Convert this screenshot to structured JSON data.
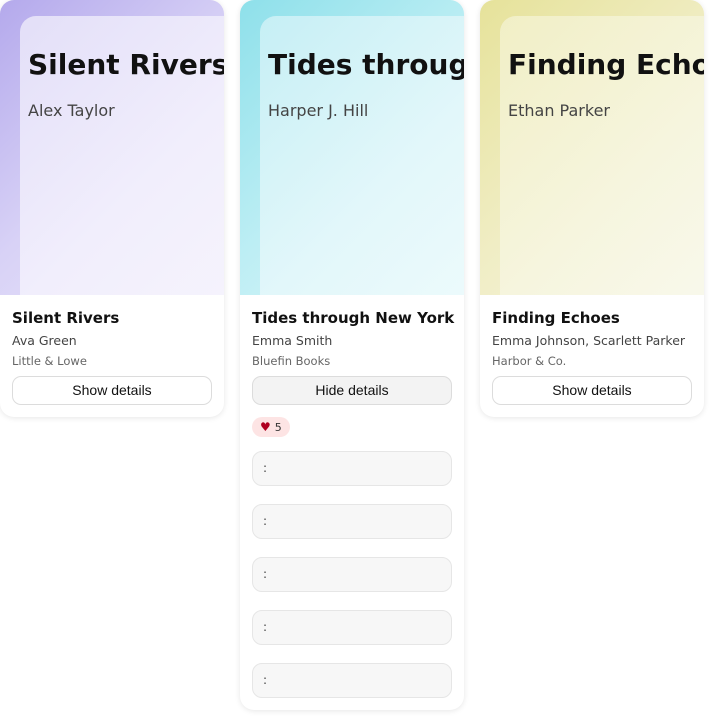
{
  "books": [
    {
      "cover_title": "Silent Rivers",
      "cover_author": "Alex Taylor",
      "title": "Silent Rivers",
      "author": "Ava Green",
      "publisher": "Little & Lowe",
      "button_label": "Show details"
    },
    {
      "cover_title": "Tides through New York",
      "cover_author": "Harper J. Hill",
      "title": "Tides through New York",
      "author": "Emma Smith",
      "publisher": "Bluefin Books",
      "button_label": "Hide details",
      "likes": "5",
      "details": [
        ":",
        ":",
        ":",
        ":",
        ":"
      ]
    },
    {
      "cover_title": "Finding Echoes",
      "cover_author": "Ethan Parker",
      "title": "Finding Echoes",
      "author": "Emma Johnson, Scarlett Parker",
      "publisher": "Harbor & Co.",
      "button_label": "Show details"
    }
  ],
  "colors": {
    "card1_cover": "#b4a9ec",
    "card2_cover": "#8ee0ea",
    "card3_cover": "#e6e29a",
    "like_badge": "#fde4e4",
    "heart": "#b00020"
  },
  "icons": {
    "like": "heart-icon"
  }
}
